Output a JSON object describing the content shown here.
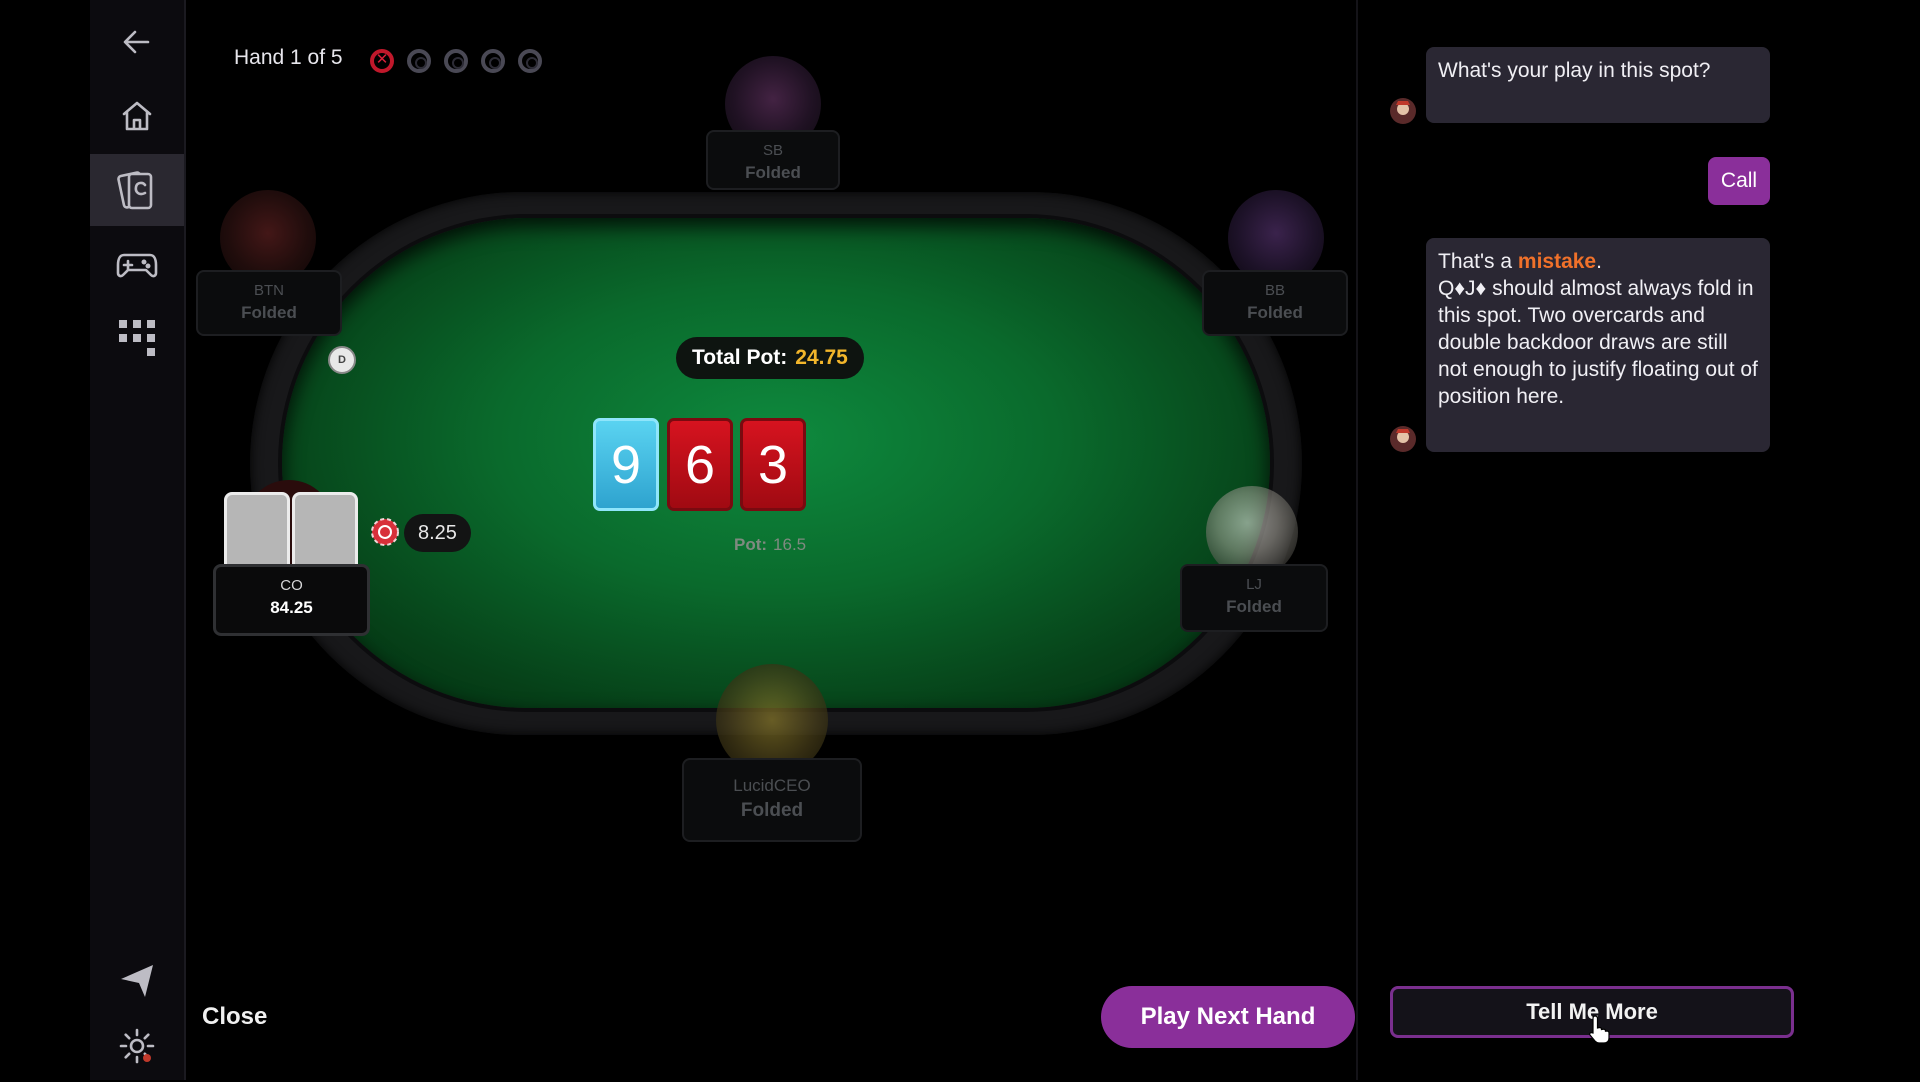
{
  "sidebar": {
    "items": [
      {
        "name": "back",
        "icon": "arrow-left-icon"
      },
      {
        "name": "home",
        "icon": "home-icon"
      },
      {
        "name": "trainer",
        "icon": "cards-icon",
        "active": true
      },
      {
        "name": "games",
        "icon": "gamepad-icon"
      },
      {
        "name": "apps",
        "icon": "grid-icon"
      },
      {
        "name": "send",
        "icon": "send-icon"
      },
      {
        "name": "settings",
        "icon": "gear-icon"
      }
    ]
  },
  "header": {
    "hand_label": "Hand 1 of 5",
    "progress": [
      "miss",
      "pending",
      "pending",
      "pending",
      "pending"
    ]
  },
  "table": {
    "total_pot_label": "Total Pot:",
    "total_pot_value": "24.75",
    "pot_label": "Pot:",
    "pot_value": "16.5",
    "board": [
      {
        "rank": "9",
        "suit": "club",
        "color": "#38b6e0"
      },
      {
        "rank": "6",
        "suit": "diamond",
        "color": "#c4101a"
      },
      {
        "rank": "3",
        "suit": "diamond",
        "color": "#c4101a"
      }
    ],
    "dealer_label": "D",
    "hero_bet": "8.25"
  },
  "seats": [
    {
      "id": "sb",
      "position": "SB",
      "status": "Folded"
    },
    {
      "id": "btn",
      "position": "BTN",
      "status": "Folded"
    },
    {
      "id": "bb",
      "position": "BB",
      "status": "Folded"
    },
    {
      "id": "co",
      "position": "CO",
      "status": "84.25",
      "hero": true
    },
    {
      "id": "lj",
      "position": "LJ",
      "status": "Folded"
    },
    {
      "id": "bottom",
      "position": "LucidCEO",
      "status": "Folded"
    }
  ],
  "buttons": {
    "close": "Close",
    "play_next_hand": "Play Next Hand",
    "tell_me_more": "Tell Me More"
  },
  "chat": {
    "question": "What's your play in this spot?",
    "user_answer": "Call",
    "feedback_prefix": "That's a ",
    "feedback_highlight": "mistake",
    "feedback_suffix": ".",
    "feedback_body": "Q♦J♦ should almost always fold in this spot. Two overcards and double backdoor draws are still not enough to justify floating out of position here.",
    "highlight_color": "#f0712a"
  },
  "colors": {
    "accent": "#8a2f9a",
    "felt": "#0a6a2c",
    "pot_value": "#f2b62b"
  }
}
